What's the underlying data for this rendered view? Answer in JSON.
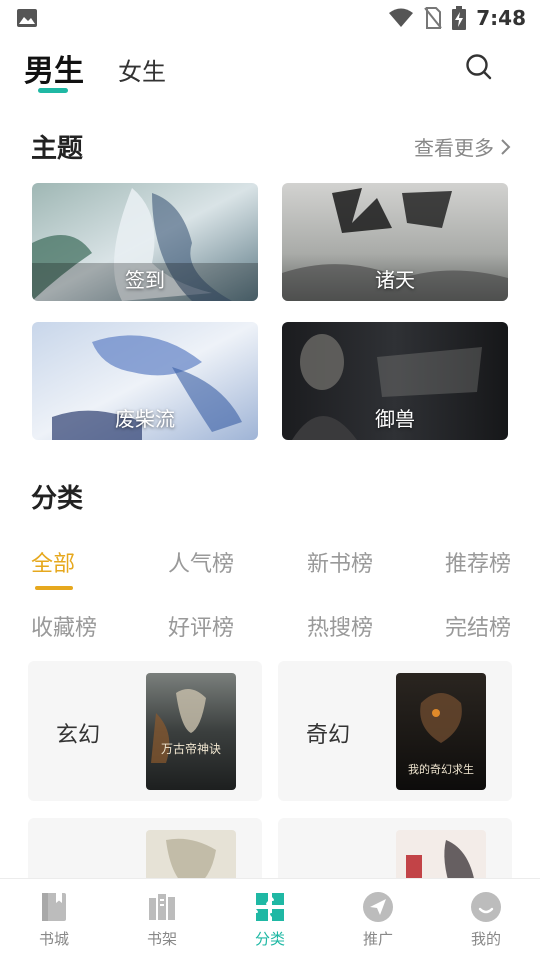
{
  "status_bar": {
    "time": "7:48"
  },
  "header": {
    "tabs": [
      {
        "label": "男生",
        "active": true
      },
      {
        "label": "女生",
        "active": false
      }
    ],
    "search_icon": "search-icon"
  },
  "theme_section": {
    "title": "主题",
    "more_label": "查看更多",
    "cards": [
      {
        "label": "签到"
      },
      {
        "label": "诸天"
      },
      {
        "label": "废柴流"
      },
      {
        "label": "御兽"
      }
    ]
  },
  "category_section": {
    "title": "分类",
    "tabs": [
      {
        "label": "全部",
        "active": true
      },
      {
        "label": "人气榜"
      },
      {
        "label": "新书榜"
      },
      {
        "label": "推荐榜"
      },
      {
        "label": "收藏榜"
      },
      {
        "label": "好评榜"
      },
      {
        "label": "热搜榜"
      },
      {
        "label": "完结榜"
      }
    ],
    "cards": [
      {
        "name": "玄幻",
        "cover_title": "万古帝神诀"
      },
      {
        "name": "奇幻",
        "cover_title": "我的奇幻求生"
      }
    ]
  },
  "bottom_nav": {
    "items": [
      {
        "label": "书城",
        "icon": "book-icon"
      },
      {
        "label": "书架",
        "icon": "bookshelf-icon"
      },
      {
        "label": "分类",
        "icon": "category-grid-icon",
        "active": true
      },
      {
        "label": "推广",
        "icon": "paper-plane-icon"
      },
      {
        "label": "我的",
        "icon": "profile-smile-icon"
      }
    ]
  },
  "colors": {
    "accent_teal": "#1fb8a4",
    "accent_orange": "#e6a81e"
  }
}
